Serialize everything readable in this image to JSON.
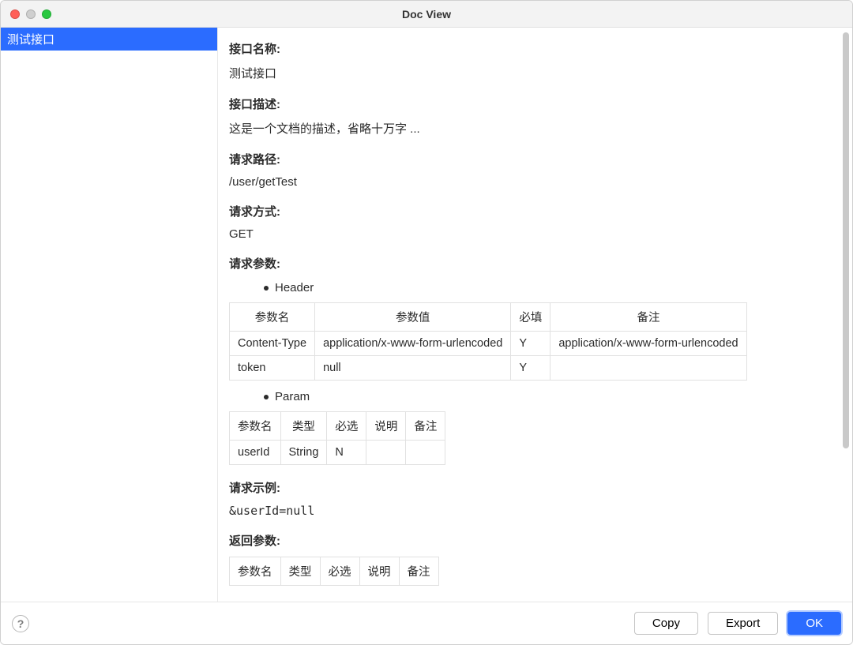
{
  "window": {
    "title": "Doc View"
  },
  "sidebar": {
    "items": [
      "测试接口"
    ]
  },
  "doc": {
    "api_name_label": "接口名称:",
    "api_name_value": "测试接口",
    "api_desc_label": "接口描述:",
    "api_desc_value": "这是一个文档的描述，省略十万字 ...",
    "path_label": "请求路径:",
    "path_value": "/user/getTest",
    "method_label": "请求方式:",
    "method_value": "GET",
    "req_params_label": "请求参数:",
    "header_bullet": "Header",
    "param_bullet": "Param",
    "req_example_label": "请求示例:",
    "req_example_value": "&userId=null",
    "resp_params_label": "返回参数:"
  },
  "header_table": {
    "columns": [
      "参数名",
      "参数值",
      "必填",
      "备注"
    ],
    "rows": [
      {
        "name": "Content-Type",
        "value": "application/x-www-form-urlencoded",
        "required": "Y",
        "remark": "application/x-www-form-urlencoded"
      },
      {
        "name": "token",
        "value": "null",
        "required": "Y",
        "remark": ""
      }
    ]
  },
  "param_table": {
    "columns": [
      "参数名",
      "类型",
      "必选",
      "说明",
      "备注"
    ],
    "rows": [
      {
        "name": "userId",
        "type": "String",
        "optional": "N",
        "desc": "",
        "remark": ""
      }
    ]
  },
  "resp_table": {
    "columns": [
      "参数名",
      "类型",
      "必选",
      "说明",
      "备注"
    ]
  },
  "footer": {
    "copy": "Copy",
    "export": "Export",
    "ok": "OK"
  }
}
